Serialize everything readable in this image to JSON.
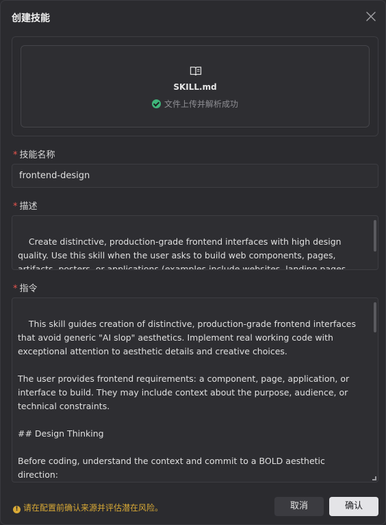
{
  "dialog": {
    "title": "创建技能",
    "close_icon": "close-icon"
  },
  "upload": {
    "icon": "book-icon",
    "file_name": "SKILL.md",
    "status_icon": "check-circle-icon",
    "status_text": "文件上传并解析成功"
  },
  "form": {
    "required_mark": "*",
    "name_label": "技能名称",
    "name_value": "frontend-design",
    "description_label": "描述",
    "description_value": "Create distinctive, production-grade frontend interfaces with high design quality. Use this skill when the user asks to build web components, pages, artifacts, posters, or applications (examples include websites, landing pages, dashboards, React components, HTML/CSS layouts, or when styling/beautifying any web UI). Generates creative, polished",
    "instruction_label": "指令",
    "instruction_value": "This skill guides creation of distinctive, production-grade frontend interfaces that avoid generic \"AI slop\" aesthetics. Implement real working code with exceptional attention to aesthetic details and creative choices.\n\nThe user provides frontend requirements: a component, page, application, or interface to build. They may include context about the purpose, audience, or technical constraints.\n\n## Design Thinking\n\nBefore coding, understand the context and commit to a BOLD aesthetic direction:\n- **Purpose**: What problem does this interface solve? Who uses it?\n- **Tone**: Pick an extreme: brutally minimal, maximalist chaos, retro-futuristic, organic/natural, luxury/refined, playful/toy-like, editorial/magazine, brutalist/raw, art"
  },
  "footer": {
    "warning_icon": "warning-icon",
    "warning_text": "请在配置前确认来源并评估潜在风险。",
    "cancel_label": "取消",
    "confirm_label": "确认"
  },
  "colors": {
    "background": "#2b2b2f",
    "required": "#e8554e",
    "success": "#3fb57a",
    "warning": "#d8a936",
    "primary_button": "#e4e4e7"
  }
}
